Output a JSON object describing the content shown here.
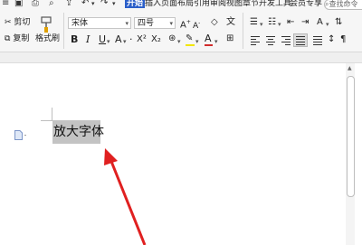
{
  "tabs": [
    "开始",
    "插入",
    "页面布局",
    "引用",
    "审阅",
    "视图",
    "章节",
    "开发工具",
    "会员专享"
  ],
  "search": {
    "text": "查找命令"
  },
  "clipboard": {
    "cut": "剪切",
    "copy": "复制",
    "format_painter": "格式刷"
  },
  "font": {
    "name": "宋体",
    "size": "四号"
  },
  "format_buttons": [
    "B",
    "I",
    "U",
    "A",
    "X²",
    "X₂",
    "A",
    "A"
  ],
  "document": {
    "selected_text": "放大字体"
  },
  "colors": {
    "active_tab": "#2b5fc9",
    "font_color_bar": "#d12b2b",
    "highlight_bar": "#f2e600",
    "arrow": "#e02020",
    "selection": "#c3c3c3"
  }
}
